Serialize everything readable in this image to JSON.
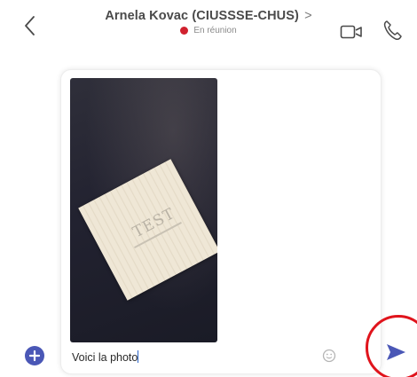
{
  "header": {
    "back_icon": "chevron-left-icon",
    "contact_name": "Arnela Kovac (CIUSSSE-CHUS)",
    "caret": ">",
    "status_text": "En réunion",
    "status_color": "#d0212e",
    "video_icon": "video-camera-icon",
    "call_icon": "phone-icon"
  },
  "compose": {
    "attachment": {
      "paper_text": "TEST"
    },
    "message_value": "Voici la photo",
    "emoji_icon": "emoji-icon",
    "add_icon": "plus-circle-icon",
    "send_icon": "send-arrow-icon",
    "accent_color": "#4a57b6",
    "highlight_color": "#e0141c"
  }
}
